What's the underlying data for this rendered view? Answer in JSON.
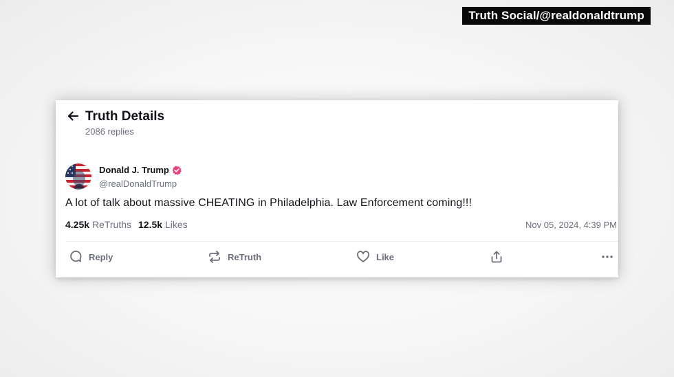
{
  "source_tag": "Truth Social/@realdonaldtrump",
  "header": {
    "title": "Truth Details",
    "replies": "2086 replies",
    "back_icon": "arrow-left-icon"
  },
  "post": {
    "author_name": "Donald J. Trump",
    "author_handle": "@realDonaldTrump",
    "verified_icon": "verified-badge-icon",
    "text": "A lot of talk about massive CHEATING in Philadelphia. Law Enforcement coming!!!",
    "retruths_count": "4.25k",
    "retruths_label": "ReTruths",
    "likes_count": "12.5k",
    "likes_label": "Likes",
    "timestamp": "Nov 05, 2024, 4:39 PM"
  },
  "actions": {
    "reply_label": "Reply",
    "retruth_label": "ReTruth",
    "like_label": "Like"
  },
  "colors": {
    "verified": "#e8457a",
    "text_primary": "#111318",
    "text_secondary": "#6b6f7a",
    "tag_background": "#0a0a0a"
  }
}
